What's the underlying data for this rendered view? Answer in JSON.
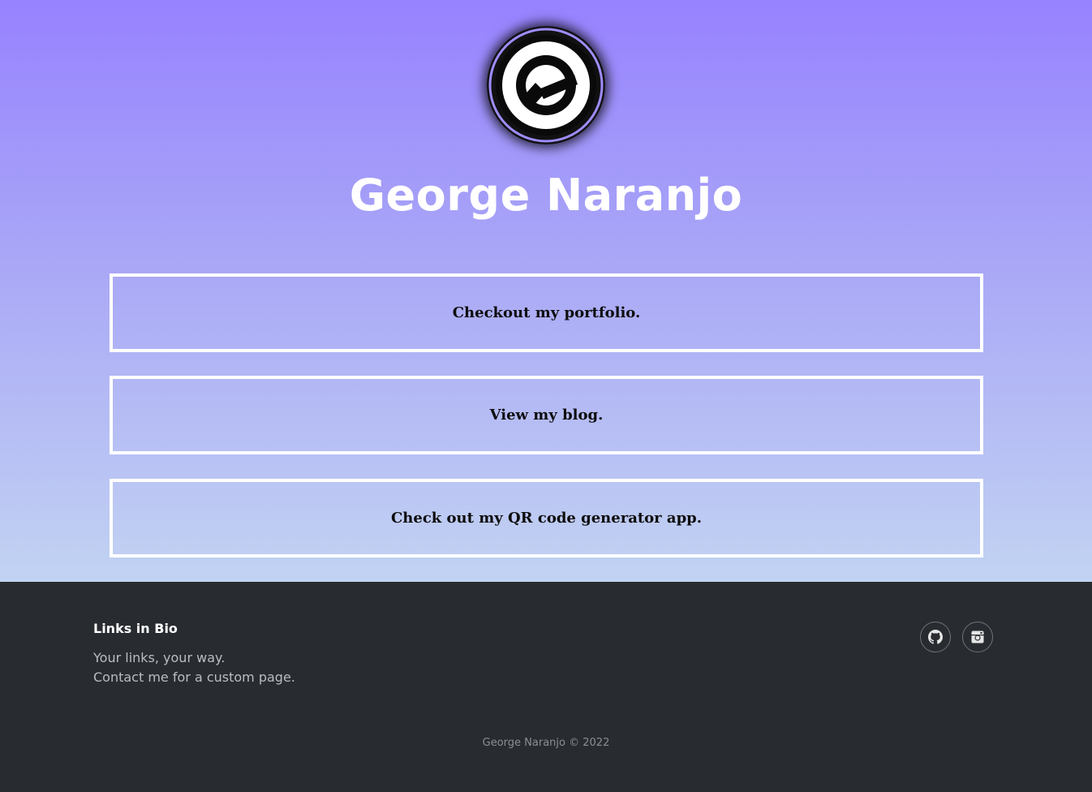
{
  "profile": {
    "name": "George Naranjo",
    "avatar_icon": "logo-avatar-icon"
  },
  "links": [
    {
      "label": "Checkout my portfolio."
    },
    {
      "label": "View my blog."
    },
    {
      "label": "Check out my QR code generator app."
    }
  ],
  "footer": {
    "title": "Links in Bio",
    "tagline": "Your links, your way.",
    "contact": "Contact me for a custom page.",
    "social": [
      {
        "icon": "github-icon"
      },
      {
        "icon": "instagram-icon"
      }
    ],
    "copyright": "George Naranjo © 2022"
  },
  "colors": {
    "gradient_top": "#9782ff",
    "gradient_bottom": "#c2d3f2",
    "footer_bg": "#282c30",
    "avatar_ring": "#a08cff"
  }
}
